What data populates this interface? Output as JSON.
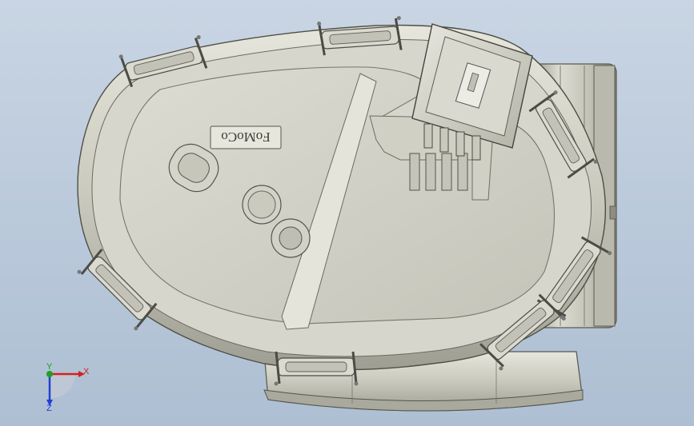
{
  "model": {
    "embossed_text": "FoMoCo"
  },
  "triad": {
    "x_label": "X",
    "y_label": "Y",
    "z_label": "Z",
    "colors": {
      "x": "#d42020",
      "y": "#20a020",
      "z": "#2040d0"
    }
  }
}
